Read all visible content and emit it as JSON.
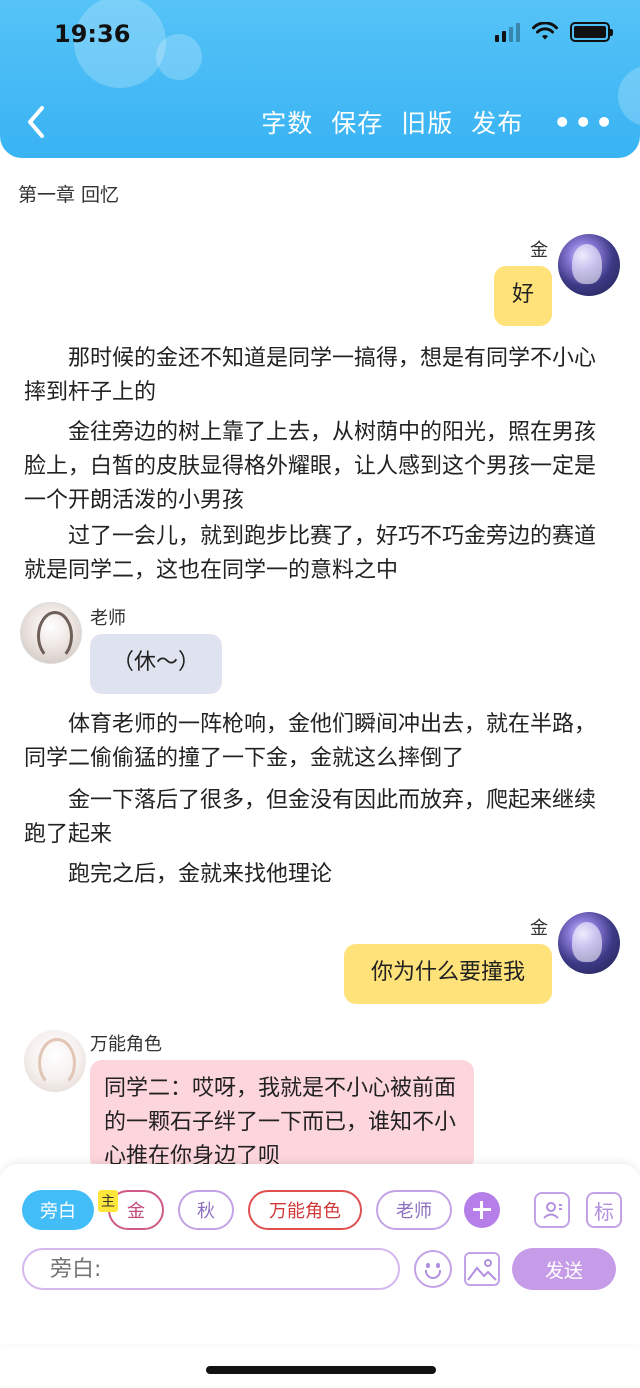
{
  "status_bar": {
    "time": "19:36"
  },
  "nav": {
    "actions": [
      "字数",
      "保存",
      "旧版",
      "发布"
    ],
    "more_label": "•••"
  },
  "chapter": {
    "title": "第一章 回忆"
  },
  "messages": [
    {
      "type": "bubble",
      "speaker": "金",
      "side": "right",
      "text": "好"
    },
    {
      "type": "narration",
      "text": "那时候的金还不知道是同学一搞得，想是有同学不小心摔到杆子上的"
    },
    {
      "type": "narration",
      "text": "金往旁边的树上靠了上去，从树荫中的阳光，照在男孩脸上，白皙的皮肤显得格外耀眼，让人感到这个男孩一定是一个开朗活泼的小男孩"
    },
    {
      "type": "narration",
      "text": "过了一会儿，就到跑步比赛了，好巧不巧金旁边的赛道就是同学二，这也在同学一的意料之中"
    },
    {
      "type": "bubble",
      "speaker": "老师",
      "side": "left",
      "text": "（休～）"
    },
    {
      "type": "narration",
      "text": "体育老师的一阵枪响，金他们瞬间冲出去，就在半路，同学二偷偷猛的撞了一下金，金就这么摔倒了"
    },
    {
      "type": "narration",
      "text": "金一下落后了很多，但金没有因此而放弃，爬起来继续跑了起来"
    },
    {
      "type": "narration",
      "text": "跑完之后，金就来找他理论"
    },
    {
      "type": "bubble",
      "speaker": "金",
      "side": "right",
      "text": "你为什么要撞我"
    },
    {
      "type": "bubble",
      "speaker": "万能角色",
      "side": "left",
      "text": "同学二：哎呀，我就是不小心被前面的一颗石子绊了一下而已，谁知不小心推在你身边了呗"
    }
  ],
  "role_bar": {
    "chips": [
      "旁白",
      "金",
      "秋",
      "万能角色",
      "老师"
    ],
    "main_tag": "主",
    "tag_button_label": "标"
  },
  "composer": {
    "placeholder": "旁白:",
    "send_label": "发送"
  },
  "colors": {
    "header": "#39b3f3",
    "bubble_right": "#ffe27a",
    "bubble_teacher": "#dfe3ef",
    "bubble_universal": "#fdd5dc",
    "accent_purple": "#c69ce9"
  }
}
